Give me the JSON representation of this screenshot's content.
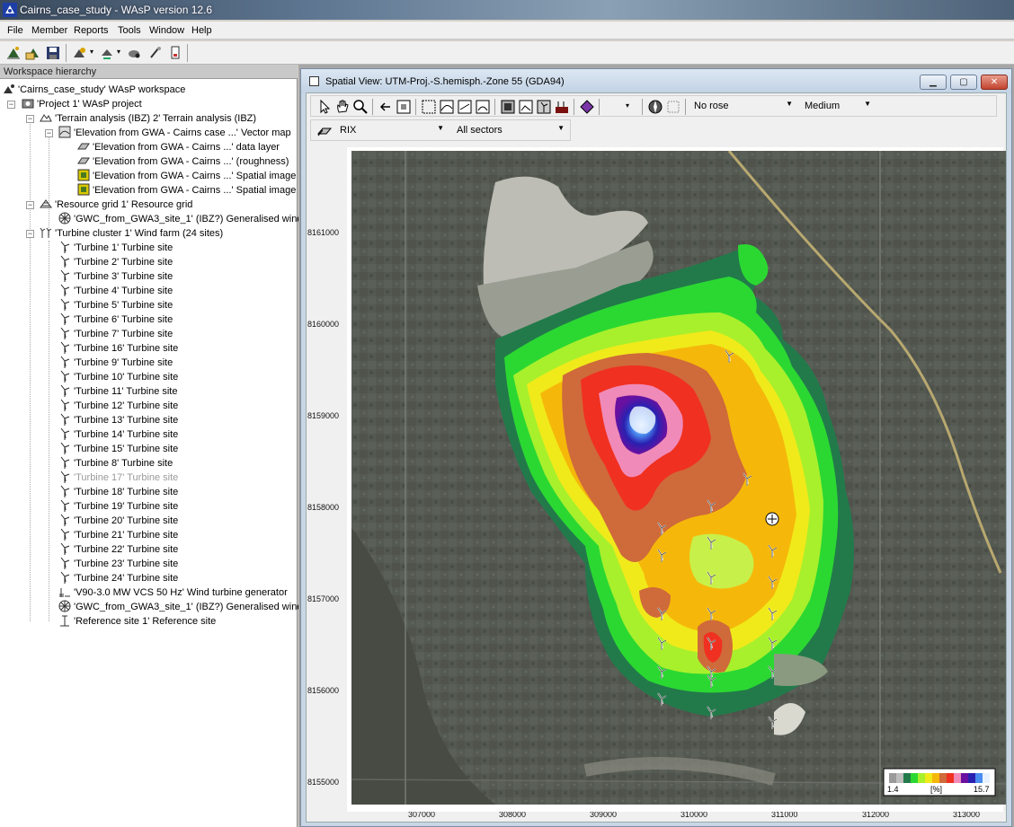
{
  "window": {
    "title": "Cairns_case_study - WAsP version 12.6"
  },
  "menu": [
    "File",
    "Member",
    "Reports",
    "Tools",
    "Window",
    "Help"
  ],
  "workspace": {
    "header": "Workspace hierarchy",
    "root": "'Cairns_case_study' WAsP workspace",
    "project": "'Project 1' WAsP project",
    "terrain": "'Terrain analysis (IBZ) 2' Terrain analysis (IBZ)",
    "elevation_map": "'Elevation from GWA - Cairns case ...' Vector map",
    "layers": [
      "'Elevation from GWA - Cairns ...' data layer",
      "'Elevation from GWA - Cairns ...' (roughness)",
      "'Elevation from GWA - Cairns ...' Spatial image",
      "'Elevation from GWA - Cairns ...' Spatial image"
    ],
    "resource_grid": "'Resource grid 1' Resource grid",
    "gwc_grid": "'GWC_from_GWA3_site_1' (IBZ?) Generalised wind",
    "turbine_cluster": "'Turbine cluster 1' Wind farm (24 sites)",
    "turbines": [
      "'Turbine 1' Turbine site",
      "'Turbine 2' Turbine site",
      "'Turbine 3' Turbine site",
      "'Turbine 4' Turbine site",
      "'Turbine 5' Turbine site",
      "'Turbine 6' Turbine site",
      "'Turbine 7' Turbine site",
      "'Turbine 16' Turbine site",
      "'Turbine 9' Turbine site",
      "'Turbine 10' Turbine site",
      "'Turbine 11' Turbine site",
      "'Turbine 12' Turbine site",
      "'Turbine 13' Turbine site",
      "'Turbine 14' Turbine site",
      "'Turbine 15' Turbine site",
      "'Turbine 8' Turbine site",
      "'Turbine 17' Turbine site",
      "'Turbine 18' Turbine site",
      "'Turbine 19' Turbine site",
      "'Turbine 20' Turbine site",
      "'Turbine 21' Turbine site",
      "'Turbine 22' Turbine site",
      "'Turbine 23' Turbine site",
      "'Turbine 24' Turbine site"
    ],
    "generator": "'V90-3.0 MW VCS 50 Hz' Wind turbine generator",
    "gwc_cluster": "'GWC_from_GWA3_site_1' (IBZ?) Generalised wind",
    "reference": "'Reference site 1' Reference site"
  },
  "spatial_view": {
    "title": "Spatial View: UTM-Proj.-S.hemisph.-Zone 55 (GDA94)",
    "rose_select": "No rose",
    "size_select": "Medium",
    "variable_select": "RIX",
    "sector_select": "All sectors",
    "y_ticks": [
      "8161000",
      "8160000",
      "8159000",
      "8158000",
      "8157000",
      "8156000",
      "8155000"
    ],
    "x_ticks": [
      "307000",
      "308000",
      "309000",
      "310000",
      "311000",
      "312000",
      "313000"
    ],
    "legend": {
      "min": "1.4",
      "unit": "[%]",
      "max": "15.7"
    }
  }
}
